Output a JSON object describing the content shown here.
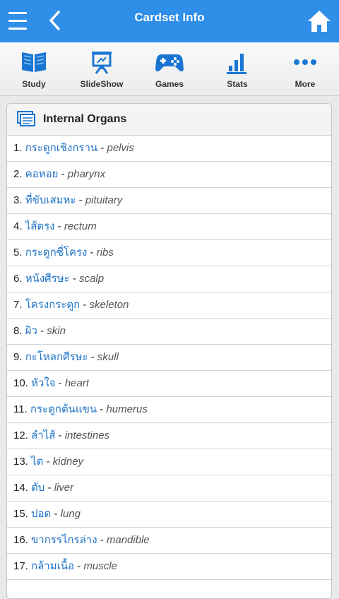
{
  "header": {
    "title": "Cardset Info"
  },
  "toolbar": {
    "items": [
      {
        "label": "Study",
        "icon": "book-icon"
      },
      {
        "label": "SlideShow",
        "icon": "slideshow-icon"
      },
      {
        "label": "Games",
        "icon": "gamepad-icon"
      },
      {
        "label": "Stats",
        "icon": "bar-chart-icon"
      },
      {
        "label": "More",
        "icon": "more-dots-icon"
      }
    ]
  },
  "cardset": {
    "title": "Internal Organs",
    "cards": [
      {
        "num": "1.",
        "term": "กระดูกเชิงกราน",
        "def": "pelvis"
      },
      {
        "num": "2.",
        "term": "คอหอย",
        "def": "pharynx"
      },
      {
        "num": "3.",
        "term": "ที่ขับเสมหะ",
        "def": "pituitary"
      },
      {
        "num": "4.",
        "term": "ไส้ตรง",
        "def": "rectum"
      },
      {
        "num": "5.",
        "term": "กระดูกซี่โครง",
        "def": "ribs"
      },
      {
        "num": "6.",
        "term": "หนังศีรษะ",
        "def": "scalp"
      },
      {
        "num": "7.",
        "term": "โครงกระดูก",
        "def": "skeleton"
      },
      {
        "num": "8.",
        "term": "ผิว",
        "def": "skin"
      },
      {
        "num": "9.",
        "term": "กะโหลกศีรษะ",
        "def": "skull"
      },
      {
        "num": "10.",
        "term": "หัวใจ",
        "def": "heart"
      },
      {
        "num": "11.",
        "term": "กระดูกต้นแขน",
        "def": "humerus"
      },
      {
        "num": "12.",
        "term": "ลำไส้",
        "def": "intestines"
      },
      {
        "num": "13.",
        "term": "ไต",
        "def": "kidney"
      },
      {
        "num": "14.",
        "term": "ตับ",
        "def": "liver"
      },
      {
        "num": "15.",
        "term": "ปอด",
        "def": "lung"
      },
      {
        "num": "16.",
        "term": "ขากรรไกรล่าง",
        "def": "mandible"
      },
      {
        "num": "17.",
        "term": "กล้ามเนื้อ",
        "def": "muscle"
      }
    ]
  },
  "colors": {
    "appbar": "#2f8ee8",
    "term": "#1e73c8",
    "icon": "#1976d2"
  }
}
